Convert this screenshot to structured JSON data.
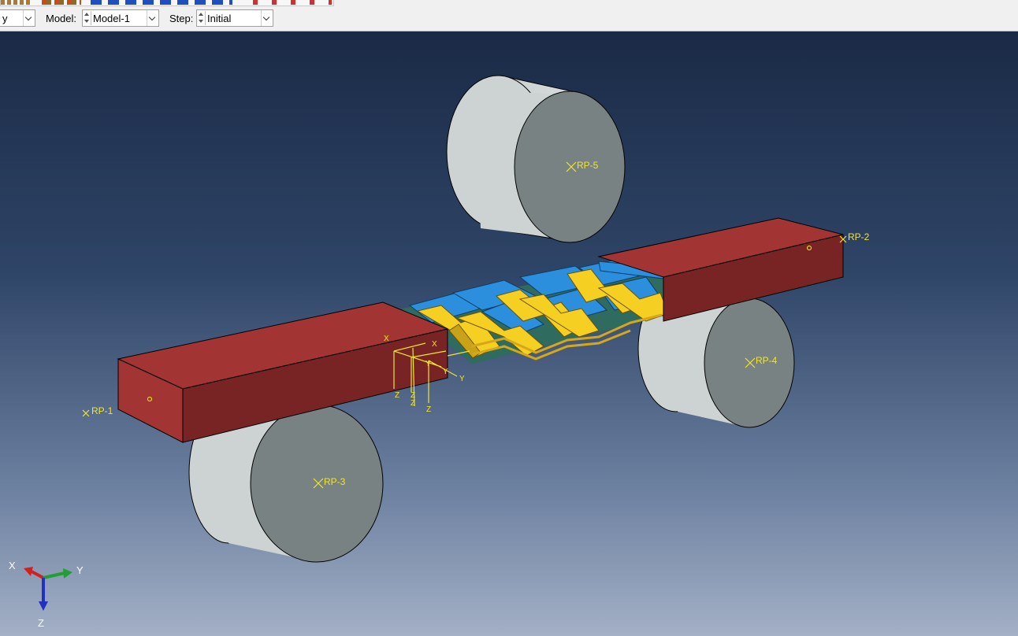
{
  "context_bar": {
    "module_value": "y",
    "model_label": "Model:",
    "model_value": "Model-1",
    "step_label": "Step:",
    "step_value": "Initial"
  },
  "viewport": {
    "reference_points": [
      "RP-5",
      "RP-2",
      "RP-4",
      "RP-1",
      "RP-3"
    ],
    "triad": {
      "x": "X",
      "y": "Y",
      "z": "Z"
    },
    "csys_labels": {
      "x": "X",
      "y": "Y",
      "z": "Z"
    }
  },
  "colors": {
    "background_top": "#1a2a46",
    "background_bottom": "#a3b0c6",
    "bar_red": "#a33434",
    "roller_gray": "#7a8585",
    "fabric_yellow": "#f5cf22",
    "fabric_blue": "#2c8fdd",
    "annotation_yellow": "#ffff00"
  },
  "icons": [
    "toolbar-icons",
    "spinner-icon",
    "dropdown-arrow-icon",
    "reference-point-icon",
    "axis-triad-icon"
  ]
}
